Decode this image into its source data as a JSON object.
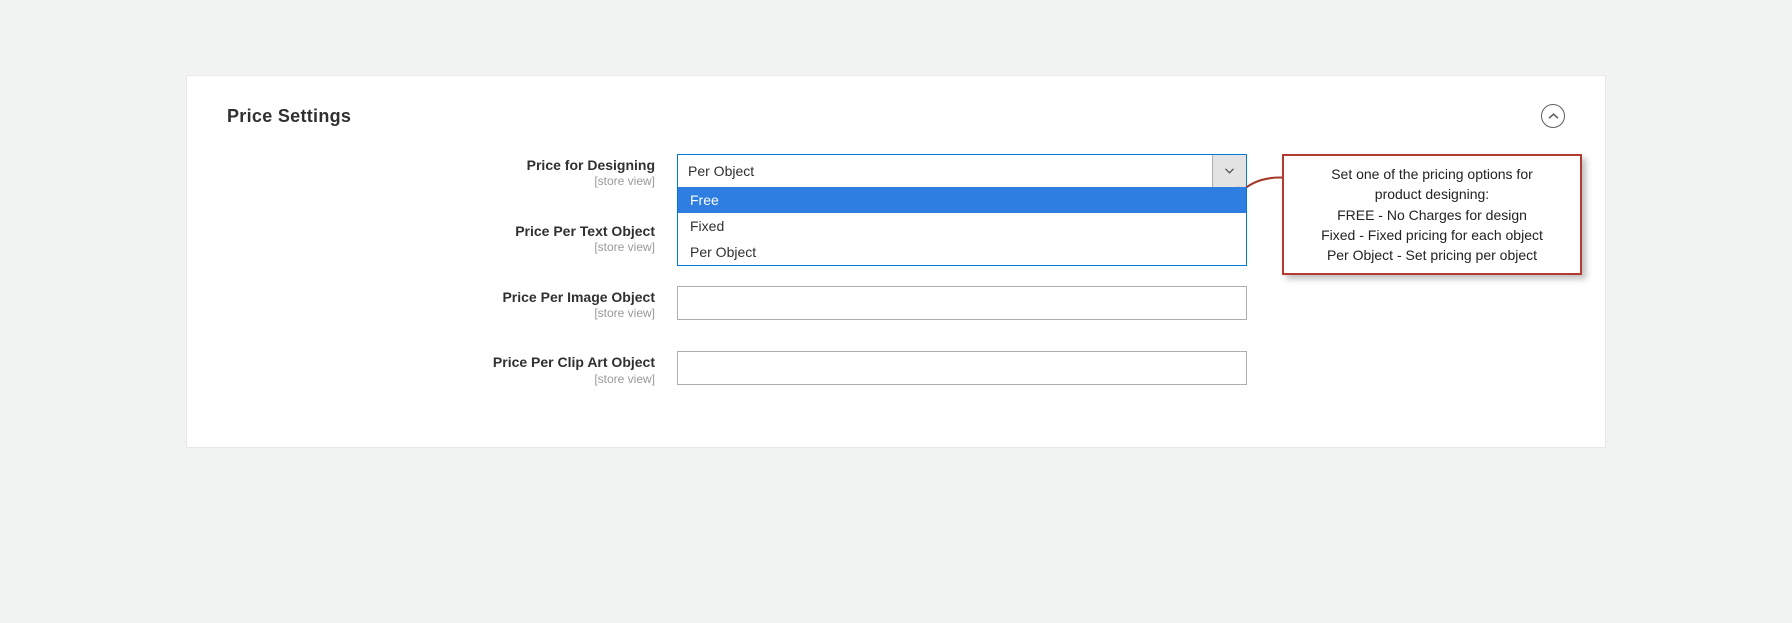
{
  "section": {
    "title": "Price Settings",
    "scope_label": "[store view]"
  },
  "fields": {
    "price_for_designing": {
      "label": "Price for Designing",
      "selected": "Per Object",
      "options": [
        "Free",
        "Fixed",
        "Per Object"
      ],
      "highlighted_index": 0
    },
    "price_per_text": {
      "label": "Price Per Text Object",
      "value": ""
    },
    "price_per_image": {
      "label": "Price Per Image Object",
      "value": ""
    },
    "price_per_clipart": {
      "label": "Price Per Clip Art Object",
      "value": ""
    }
  },
  "callout": {
    "line1": "Set one of the pricing options for",
    "line2": "product designing:",
    "line3": "FREE - No Charges for design",
    "line4": "Fixed - Fixed pricing for each object",
    "line5": "Per Object - Set pricing per object"
  }
}
